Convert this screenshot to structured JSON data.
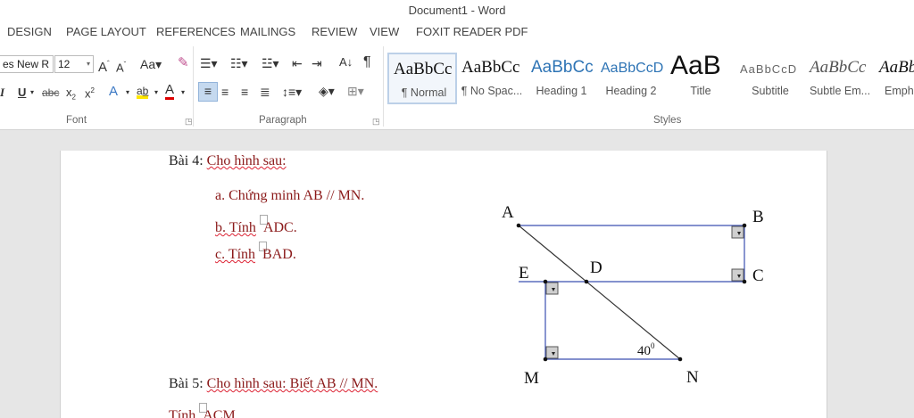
{
  "titlebar": {
    "title": "Document1 - Word"
  },
  "tabs": [
    "DESIGN",
    "PAGE LAYOUT",
    "REFERENCES",
    "MAILINGS",
    "REVIEW",
    "VIEW",
    "FOXIT READER PDF"
  ],
  "font_group": {
    "font_name": "es New R",
    "font_size": "12",
    "label": "Font"
  },
  "paragraph_group": {
    "label": "Paragraph"
  },
  "styles_group": {
    "label": "Styles",
    "items": [
      {
        "preview": "AaBbCc",
        "name": "¶ Normal"
      },
      {
        "preview": "AaBbCc",
        "name": "¶ No Spac..."
      },
      {
        "preview": "AaBbCc",
        "name": "Heading 1"
      },
      {
        "preview": "AaBbCcD",
        "name": "Heading 2"
      },
      {
        "preview": "AaB",
        "name": "Title"
      },
      {
        "preview": "AaBbCcD",
        "name": "Subtitle"
      },
      {
        "preview": "AaBbCc",
        "name": "Subtle Em..."
      },
      {
        "preview": "AaBb",
        "name": "Emph"
      }
    ]
  },
  "document": {
    "bai4_label": "Bài 4:",
    "bai4_text": "Cho hình sau:",
    "item_a": "a. Chứng minh AB // MN.",
    "item_b_prefix": "b. Tính",
    "item_b_angle": "ADC",
    "item_c_prefix": "c. Tính",
    "item_c_angle": "BAD",
    "period": ".",
    "bai5_label": "Bài 5:",
    "bai5_text": "Cho hình sau: Biết AB // MN.",
    "bai5_line2_prefix": "Tính",
    "bai5_line2_angle": "ACM",
    "figure": {
      "points": [
        "A",
        "B",
        "C",
        "D",
        "E",
        "M",
        "N"
      ],
      "angle_label": "40",
      "angle_unit": "0"
    }
  },
  "colors": {
    "document_text": "#8b1a1a",
    "figure_lines_blue": "#3a4fb0",
    "style_heading_blue": "#2e74b5"
  }
}
